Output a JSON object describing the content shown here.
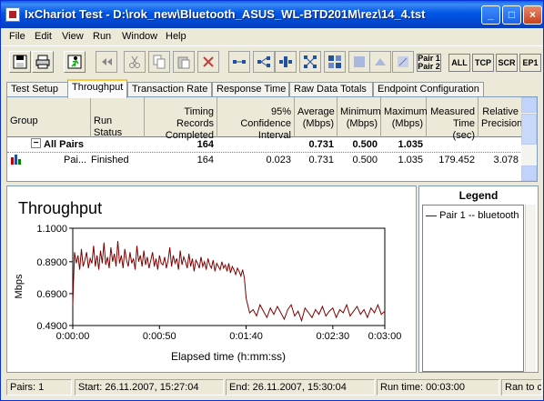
{
  "window": {
    "title": "IxChariot Test - D:\\rok_new\\Bluetooth_ASUS_WL-BTD201M\\rez\\14_4.tst",
    "minimize": "_",
    "maximize": "□",
    "close": "×"
  },
  "menu": [
    "File",
    "Edit",
    "View",
    "Run",
    "Window",
    "Help"
  ],
  "toolbar": {
    "pair12_top": "Pair 1",
    "pair12_bottom": "Pair 2",
    "all": "ALL",
    "tcp": "TCP",
    "scr": "SCR",
    "ep1": "EP1"
  },
  "tabs": [
    "Test Setup",
    "Throughput",
    "Transaction Rate",
    "Response Time",
    "Raw Data Totals",
    "Endpoint Configuration"
  ],
  "grid": {
    "headers": [
      "Group",
      "Run Status",
      "Timing Records Completed",
      "95% Confidence Interval",
      "Average (Mbps)",
      "Minimum (Mbps)",
      "Maximum (Mbps)",
      "Measured Time (sec)",
      "Relative Precision"
    ],
    "all_pairs": {
      "label": "All Pairs",
      "expander": "−",
      "records": "164",
      "average": "0.731",
      "minimum": "0.500",
      "maximum": "1.035"
    },
    "pair_row": {
      "label": "Pai...",
      "status": "Finished",
      "records": "164",
      "confidence": "0.023",
      "average": "0.731",
      "minimum": "0.500",
      "maximum": "1.035",
      "time": "179.452",
      "precision": "3.078"
    }
  },
  "chart_data": {
    "type": "line",
    "title": "Throughput",
    "xlabel": "Elapsed time (h:mm:ss)",
    "ylabel": "Mbps",
    "x_ticks": [
      "0:00:00",
      "0:00:50",
      "0:01:40",
      "0:02:30",
      "0:03:00"
    ],
    "x_tick_seconds": [
      0,
      50,
      100,
      150,
      180
    ],
    "y_ticks": [
      "1.1000",
      "0.8900",
      "0.6900",
      "0.4900"
    ],
    "ylim": [
      0.49,
      1.1
    ],
    "xlim": [
      0,
      180
    ],
    "series_color": "#800000",
    "series": [
      {
        "name": "Pair 1 -- bluetooth",
        "x": [
          0,
          1,
          2,
          3,
          4,
          5,
          6,
          7,
          8,
          9,
          10,
          11,
          12,
          13,
          14,
          15,
          16,
          17,
          18,
          19,
          20,
          21,
          22,
          23,
          24,
          25,
          26,
          27,
          28,
          29,
          30,
          31,
          32,
          33,
          34,
          35,
          36,
          37,
          38,
          39,
          40,
          41,
          42,
          43,
          44,
          45,
          46,
          47,
          48,
          49,
          50,
          51,
          52,
          53,
          54,
          55,
          56,
          57,
          58,
          59,
          60,
          61,
          62,
          63,
          64,
          65,
          66,
          67,
          68,
          69,
          70,
          71,
          72,
          73,
          74,
          75,
          76,
          77,
          78,
          79,
          80,
          81,
          82,
          83,
          84,
          85,
          86,
          87,
          88,
          89,
          90,
          91,
          92,
          93,
          94,
          95,
          96,
          97,
          98,
          99,
          100,
          102,
          104,
          106,
          108,
          110,
          112,
          114,
          116,
          118,
          120,
          122,
          124,
          126,
          128,
          130,
          132,
          134,
          136,
          138,
          140,
          142,
          144,
          146,
          148,
          150,
          152,
          154,
          156,
          158,
          160,
          162,
          164,
          166,
          168,
          170,
          172,
          174,
          176,
          178,
          180
        ],
        "y": [
          0.62,
          0.95,
          0.88,
          0.93,
          0.84,
          0.97,
          0.86,
          0.9,
          0.95,
          0.85,
          0.91,
          0.88,
          0.99,
          0.86,
          0.93,
          0.84,
          0.96,
          0.88,
          1.01,
          0.87,
          0.92,
          0.85,
          0.98,
          0.89,
          0.94,
          0.86,
          1.02,
          0.88,
          0.93,
          0.85,
          0.97,
          0.9,
          0.86,
          0.95,
          0.88,
          0.91,
          0.84,
          0.99,
          0.89,
          0.93,
          0.86,
          0.96,
          0.87,
          0.92,
          0.85,
          0.9,
          0.95,
          0.86,
          0.91,
          0.84,
          0.93,
          0.88,
          0.87,
          0.92,
          0.85,
          0.9,
          0.98,
          0.86,
          0.93,
          0.88,
          0.91,
          0.84,
          0.96,
          0.87,
          0.92,
          0.89,
          0.85,
          0.94,
          0.86,
          0.91,
          0.83,
          0.9,
          0.88,
          0.85,
          0.92,
          0.86,
          0.89,
          0.84,
          0.91,
          0.87,
          0.85,
          0.9,
          0.83,
          0.88,
          0.86,
          0.84,
          0.89,
          0.85,
          0.87,
          0.83,
          0.88,
          0.82,
          0.86,
          0.84,
          0.81,
          0.85,
          0.83,
          0.8,
          0.84,
          0.79,
          0.66,
          0.57,
          0.59,
          0.55,
          0.62,
          0.58,
          0.54,
          0.6,
          0.56,
          0.61,
          0.57,
          0.53,
          0.59,
          0.62,
          0.55,
          0.58,
          0.52,
          0.6,
          0.57,
          0.54,
          0.59,
          0.56,
          0.61,
          0.55,
          0.58,
          0.6,
          0.54,
          0.59,
          0.57,
          0.62,
          0.55,
          0.58,
          0.61,
          0.56,
          0.59,
          0.54,
          0.6,
          0.57,
          0.62,
          0.56,
          0.58
        ]
      }
    ]
  },
  "legend": {
    "title": "Legend",
    "entry": "Pair 1 -- bluetooth"
  },
  "status": {
    "pairs": "Pairs: 1",
    "start": "Start: 26.11.2007, 15:27:04",
    "end": "End: 26.11.2007, 15:30:04",
    "runtime": "Run time: 00:03:00",
    "ran": "Ran to completion"
  }
}
